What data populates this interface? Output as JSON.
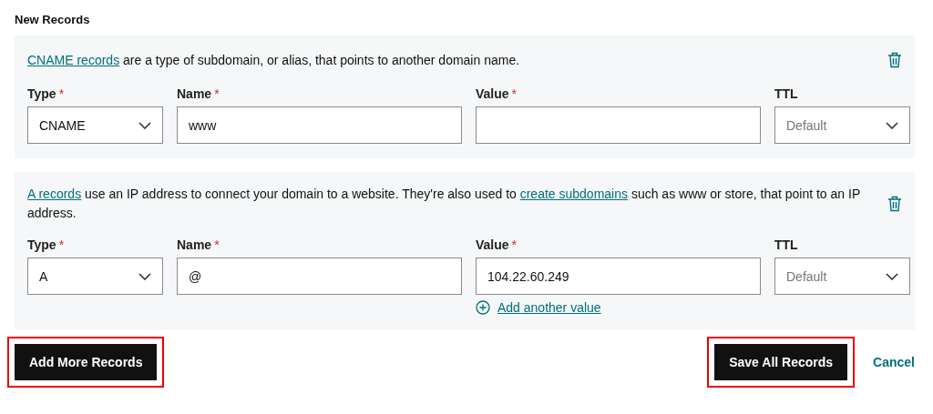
{
  "heading": "New Records",
  "records": [
    {
      "intro": [
        {
          "text": "CNAME records",
          "link": true
        },
        {
          "text": " are a type of subdomain, or alias, that points to another domain name.",
          "link": false
        }
      ],
      "fields": [
        {
          "label": "Type",
          "mark": "*",
          "kind": "select",
          "value": "CNAME"
        },
        {
          "label": "Name",
          "mark": "*",
          "kind": "text",
          "value": "www"
        },
        {
          "label": "Value",
          "mark": "*",
          "kind": "text"
        },
        {
          "label": "TTL",
          "kind": "select",
          "placeholder": "Default"
        }
      ]
    },
    {
      "intro": [
        {
          "text": "A records",
          "link": true
        },
        {
          "text": " use an IP address to connect your domain to a website. They're also used to ",
          "link": false
        },
        {
          "text": "create subdomains",
          "link": true
        },
        {
          "text": " such as www or store, that point to an IP address.",
          "link": false
        }
      ],
      "fields": [
        {
          "label": "Type",
          "mark": "*",
          "kind": "select",
          "value": "A"
        },
        {
          "label": "Name",
          "mark": "*",
          "kind": "text",
          "value": "@"
        },
        {
          "label": "Value",
          "mark": "*",
          "kind": "text",
          "value": "104.22.60.249",
          "add_link": "Add another value"
        },
        {
          "label": "TTL",
          "kind": "select",
          "placeholder": "Default"
        }
      ]
    }
  ],
  "actions": {
    "add": {
      "label": "Add More Records",
      "highlighted": true
    },
    "save": {
      "label": "Save All Records",
      "highlighted": true
    },
    "cancel": "Cancel"
  }
}
